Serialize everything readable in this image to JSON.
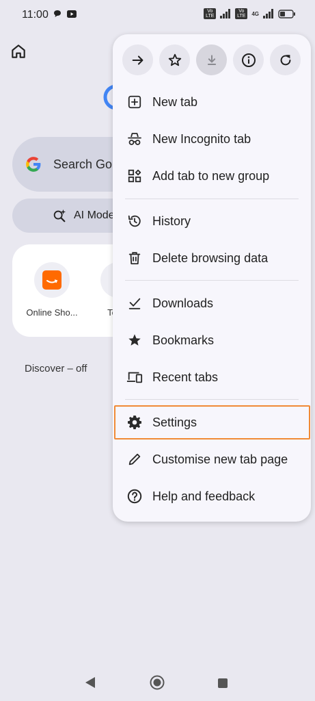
{
  "status_bar": {
    "time": "11:00",
    "left_icons": [
      "chat-bubble-icon",
      "youtube-icon"
    ],
    "volte1": "Vo LTE",
    "volte2": "Vo LTE",
    "network": "4G",
    "battery_icon": "battery-icon"
  },
  "background": {
    "search_placeholder": "Search Go",
    "ai_mode_label": "AI Mode",
    "tiles": [
      {
        "label": "Online Sho...",
        "icon": "amazon-icon",
        "color": "#ff6a00"
      },
      {
        "label": "Team",
        "icon": "game-icon",
        "color": "#c0392b"
      }
    ],
    "discover_label": "Discover – off"
  },
  "menu": {
    "toolbar": [
      {
        "name": "forward-button",
        "icon": "arrow-right-icon"
      },
      {
        "name": "bookmark-star-button",
        "icon": "star-icon"
      },
      {
        "name": "download-page-button",
        "icon": "download-icon"
      },
      {
        "name": "page-info-button",
        "icon": "info-icon"
      },
      {
        "name": "reload-button",
        "icon": "refresh-icon"
      }
    ],
    "items": [
      {
        "label": "New tab",
        "icon": "plus-square-icon"
      },
      {
        "label": "New Incognito tab",
        "icon": "incognito-icon"
      },
      {
        "label": "Add tab to new group",
        "icon": "tab-group-icon"
      },
      {
        "label": "History",
        "icon": "history-icon"
      },
      {
        "label": "Delete browsing data",
        "icon": "trash-icon"
      },
      {
        "label": "Downloads",
        "icon": "download-check-icon"
      },
      {
        "label": "Bookmarks",
        "icon": "star-filled-icon"
      },
      {
        "label": "Recent tabs",
        "icon": "devices-icon"
      },
      {
        "label": "Settings",
        "icon": "gear-icon"
      },
      {
        "label": "Customise new tab page",
        "icon": "pencil-icon"
      },
      {
        "label": "Help and feedback",
        "icon": "help-icon"
      }
    ],
    "highlighted_item": "Settings",
    "highlight_color": "#f08a35"
  },
  "nav_bar": {
    "buttons": [
      "back-icon",
      "home-icon",
      "recents-icon"
    ]
  }
}
